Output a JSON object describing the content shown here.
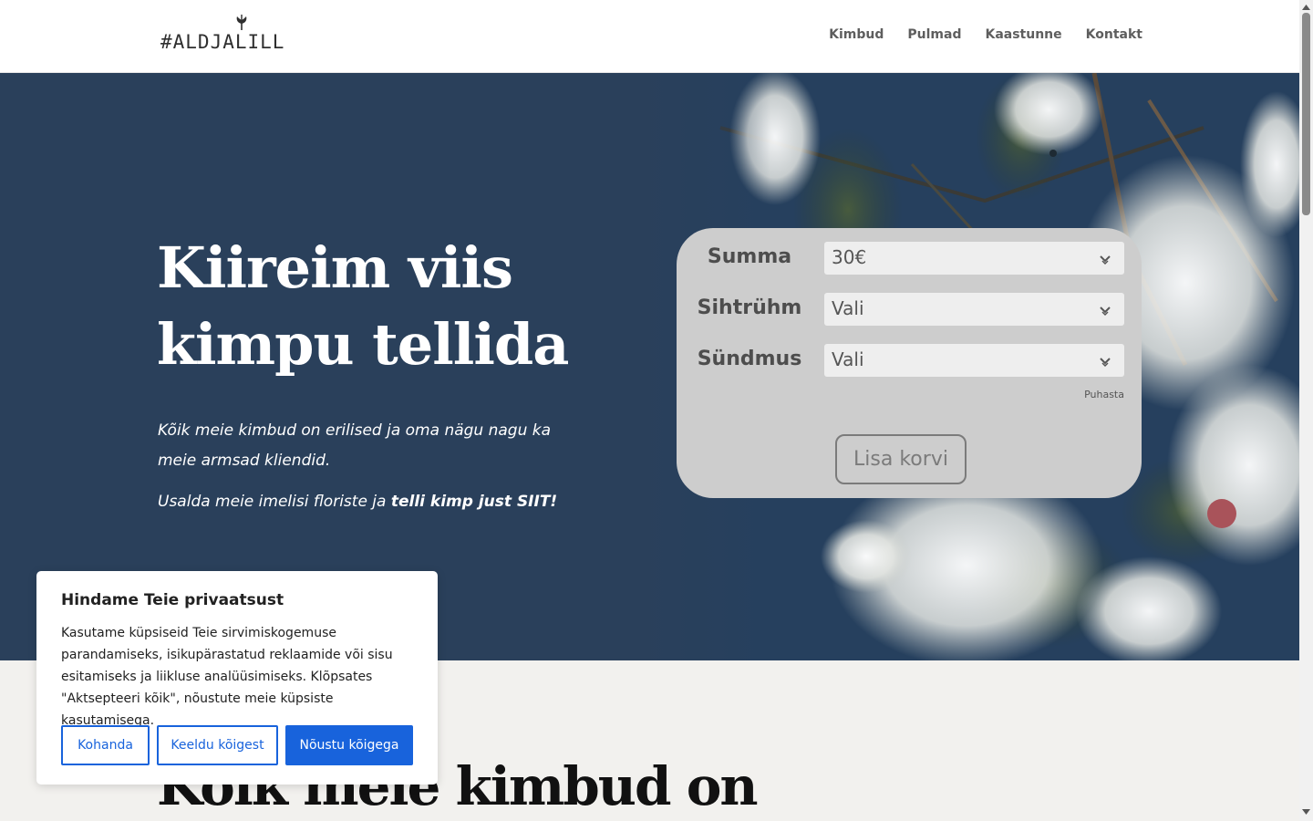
{
  "header": {
    "logo_text": "#ALDJALILL",
    "nav": [
      "Kimbud",
      "Pulmad",
      "Kaastunne",
      "Kontakt"
    ]
  },
  "hero": {
    "headline_line1": "Kiireim viis",
    "headline_line2": "kimpu tellida",
    "tagline": "Kõik meie kimbud on erilised ja oma nägu nagu ka meie armsad kliendid.",
    "tagline2_plain": "Usalda meie imelisi floriste ja ",
    "tagline2_bold": "telli kimp just SIIT!"
  },
  "order_form": {
    "fields": [
      {
        "label": "Summa",
        "value": "30€"
      },
      {
        "label": "Sihtrühm",
        "value": "Vali"
      },
      {
        "label": "Sündmus",
        "value": "Vali"
      }
    ],
    "clear_label": "Puhasta",
    "add_to_cart_label": "Lisa korvi"
  },
  "section": {
    "heading": "Kõik meie kimbud on"
  },
  "cookie_banner": {
    "title": "Hindame Teie privaatsust",
    "text": "Kasutame küpsiseid Teie sirvimiskogemuse parandamiseks, isikupärastatud reklaamide või sisu esitamiseks ja liikluse analüüsimiseks. Klõpsates \"Aktsepteeri kõik\", nõustute meie küpsiste kasutamisega.",
    "customize_label": "Kohanda",
    "reject_label": "Keeldu kõigest",
    "accept_label": "Nõustu kõigega"
  },
  "colors": {
    "hero_bg": "#2a405b",
    "form_bg": "#cdcdcd",
    "accent_blue": "#1863dc",
    "page_bg": "#f2f1ee"
  },
  "icons": [
    "logo-bud-icon",
    "chevron-down-icon",
    "scroll-up-arrow-icon",
    "scroll-down-arrow-icon"
  ]
}
